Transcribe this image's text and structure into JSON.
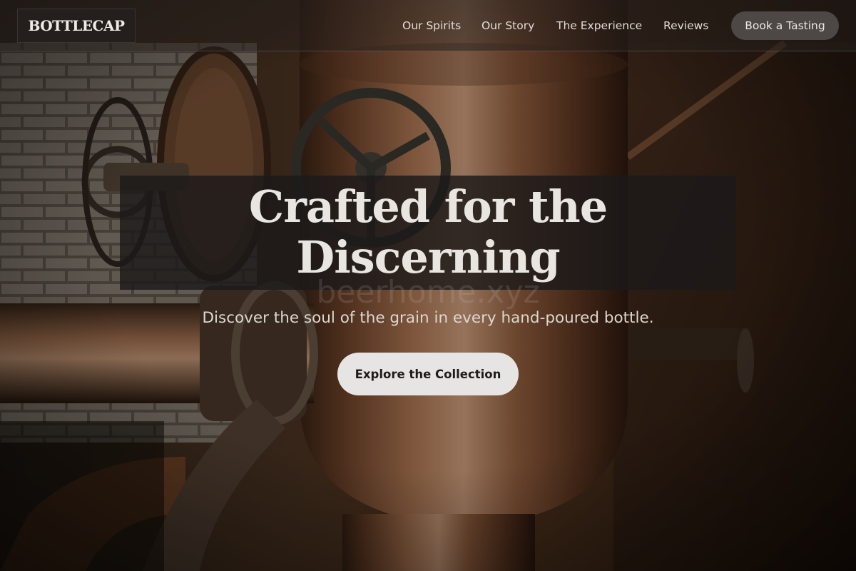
{
  "header": {
    "logo_text": "BOTTLECAP",
    "nav": [
      {
        "label": "Our Spirits"
      },
      {
        "label": "Our Story"
      },
      {
        "label": "The Experience"
      },
      {
        "label": "Reviews"
      }
    ],
    "cta_label": "Book a Tasting"
  },
  "hero": {
    "headline_line1": "Crafted for the",
    "headline_line2": "Discerning",
    "subheadline": "Discover the soul of the grain in every hand-poured bottle.",
    "cta_label": "Explore the Collection",
    "watermark_text": "beerhome.xyz",
    "background_image": "copper-still-distillery"
  },
  "colors": {
    "header_bg": "#28211d",
    "header_cta_bg": "#4d4846",
    "hero_cta_bg": "#e7e5e3",
    "headline_box_bg": "#1c1a1a",
    "text_light": "#e9e6e2",
    "copper": "#8a5a34"
  }
}
